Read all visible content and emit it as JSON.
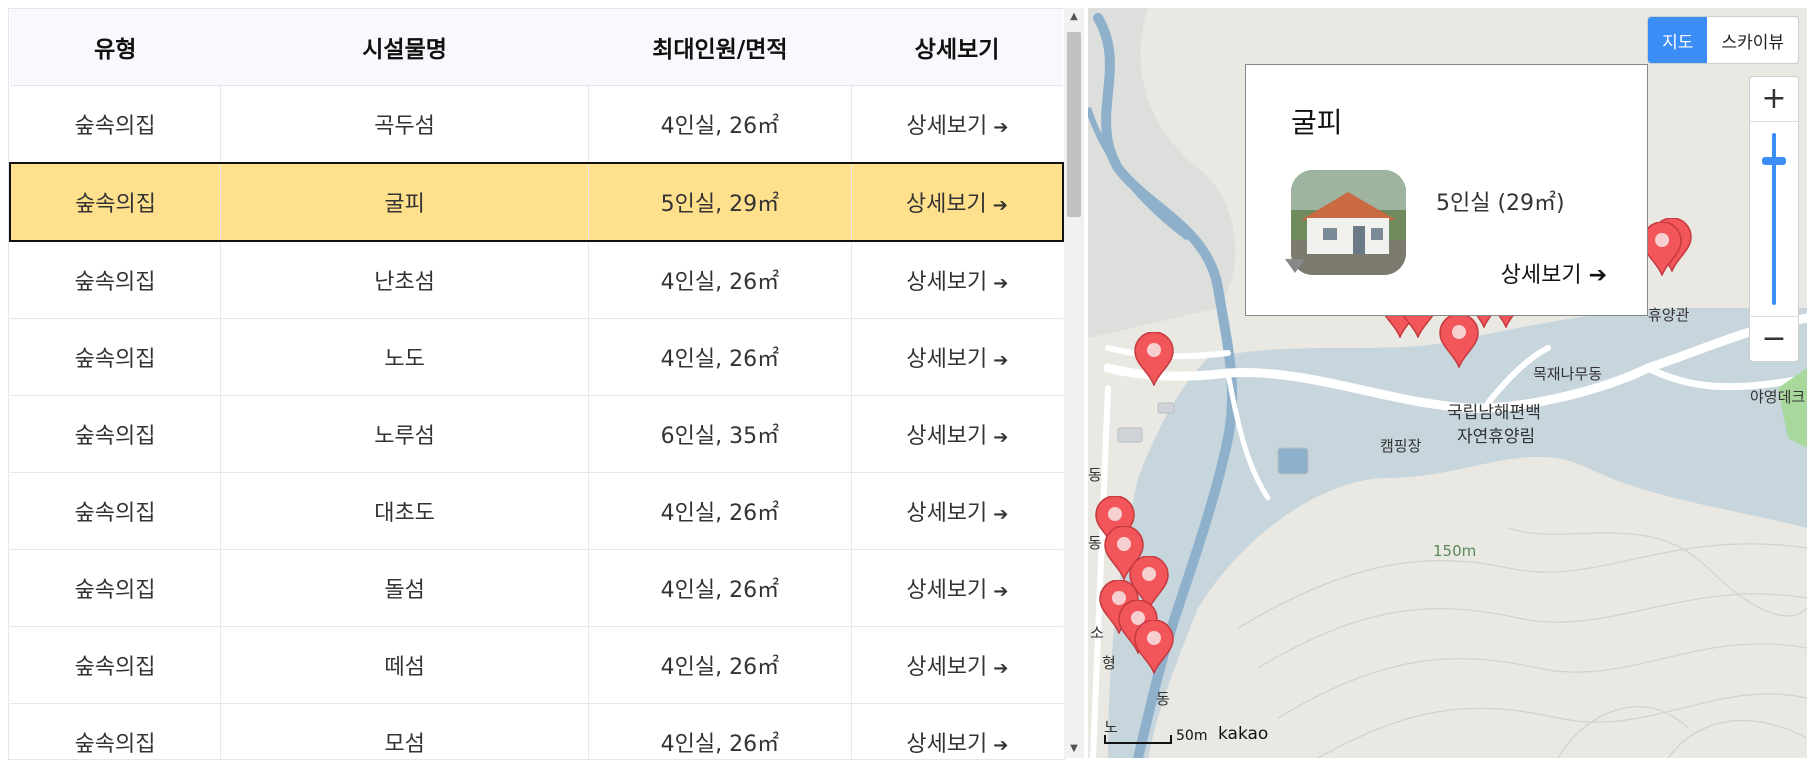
{
  "table": {
    "headers": [
      "유형",
      "시설물명",
      "최대인원/면적",
      "상세보기"
    ],
    "rows": [
      {
        "type": "숲속의집",
        "name": "곡두섬",
        "capacity": "4인실, 26㎡",
        "detail": "상세보기"
      },
      {
        "type": "숲속의집",
        "name": "굴피",
        "capacity": "5인실, 29㎡",
        "detail": "상세보기",
        "selected": true
      },
      {
        "type": "숲속의집",
        "name": "난초섬",
        "capacity": "4인실, 26㎡",
        "detail": "상세보기"
      },
      {
        "type": "숲속의집",
        "name": "노도",
        "capacity": "4인실, 26㎡",
        "detail": "상세보기"
      },
      {
        "type": "숲속의집",
        "name": "노루섬",
        "capacity": "6인실, 35㎡",
        "detail": "상세보기"
      },
      {
        "type": "숲속의집",
        "name": "대초도",
        "capacity": "4인실, 26㎡",
        "detail": "상세보기"
      },
      {
        "type": "숲속의집",
        "name": "돌섬",
        "capacity": "4인실, 26㎡",
        "detail": "상세보기"
      },
      {
        "type": "숲속의집",
        "name": "떼섬",
        "capacity": "4인실, 26㎡",
        "detail": "상세보기"
      },
      {
        "type": "숲속의집",
        "name": "모섬",
        "capacity": "4인실, 26㎡",
        "detail": "상세보기"
      }
    ],
    "detail_arrow": "➔"
  },
  "map": {
    "type_buttons": [
      {
        "label": "지도",
        "active": true
      },
      {
        "label": "스카이뷰",
        "active": false
      }
    ],
    "zoom": {
      "in": "+",
      "out": "−"
    },
    "info_window": {
      "title": "굴피",
      "capacity": "5인실 (29㎡)",
      "link": "상세보기 ➔"
    },
    "labels": {
      "forest_name_1": "국립남해편백",
      "forest_name_2": "자연휴양림",
      "camping": "캠핑장",
      "recreation_hall": "휴양관",
      "wood_house": "목재나무동",
      "deck": "야영데크",
      "contour": "150m",
      "dong1": "동",
      "dong2": "동",
      "so": "소",
      "hyeong": "형",
      "no": "노",
      "dong3": "동"
    },
    "scale": "50m",
    "logo": "kakao",
    "colors": {
      "water": "#c7d5dd",
      "stream": "#8fb0cb",
      "land": "#e9e8e2",
      "road": "#ffffff",
      "pin": "#f2555a",
      "accent": "#3b8ef5",
      "highlight_row": "#ffe08c"
    }
  }
}
